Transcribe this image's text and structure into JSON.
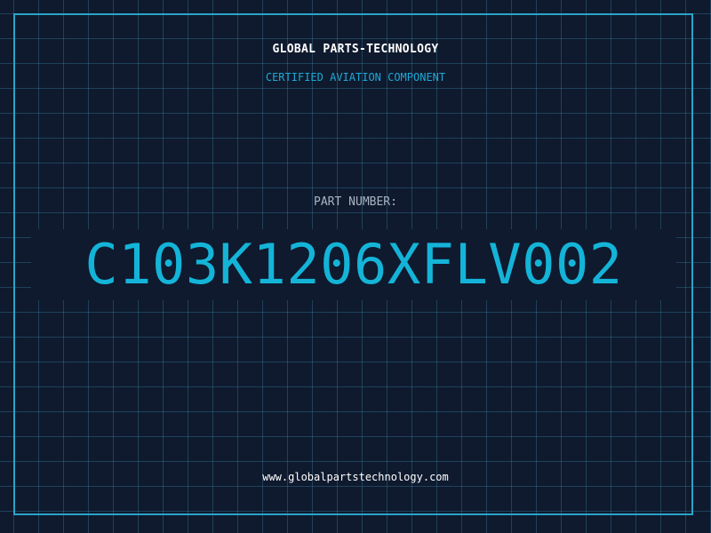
{
  "header": {
    "company": "GLOBAL PARTS-TECHNOLOGY",
    "subtitle": "CERTIFIED AVIATION COMPONENT"
  },
  "part": {
    "label": "PART NUMBER:",
    "number": "C103K1206XFLV002"
  },
  "footer": {
    "website": "www.globalpartstechnology.com"
  },
  "colors": {
    "background": "#0f1a2e",
    "grid": "#388caa",
    "frame": "#2aa4c8",
    "accent": "#14b4d8"
  }
}
